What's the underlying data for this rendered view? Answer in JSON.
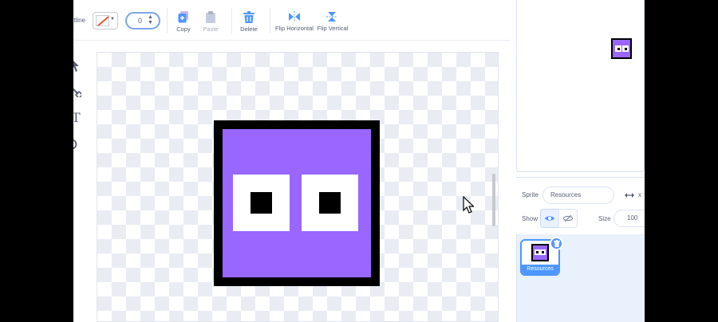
{
  "toolbar": {
    "outline_label": "utline",
    "stroke_width": "0",
    "copy_label": "Copy",
    "paste_label": "Paste",
    "delete_label": "Delete",
    "flip_horizontal_label": "Flip Horizontal",
    "flip_vertical_label": "Flip Vertical"
  },
  "left_tools": {
    "text_tool_glyph": "T"
  },
  "sprite_info": {
    "sprite_label": "Sprite",
    "sprite_name": "Resources",
    "x_label": "x",
    "show_label": "Show",
    "size_label": "Size",
    "size_value": "100"
  },
  "sprite_list": {
    "items": [
      {
        "name": "Resources"
      }
    ]
  },
  "colors": {
    "accent": "#4c97ff",
    "costume_fill": "#9966ff",
    "costume_outline": "#000000",
    "text": "#575e75"
  },
  "icons": {
    "copy": "copy-icon",
    "paste": "paste-icon",
    "delete": "trash-icon",
    "flip_horizontal": "flip-horizontal-icon",
    "flip_vertical": "flip-vertical-icon"
  }
}
